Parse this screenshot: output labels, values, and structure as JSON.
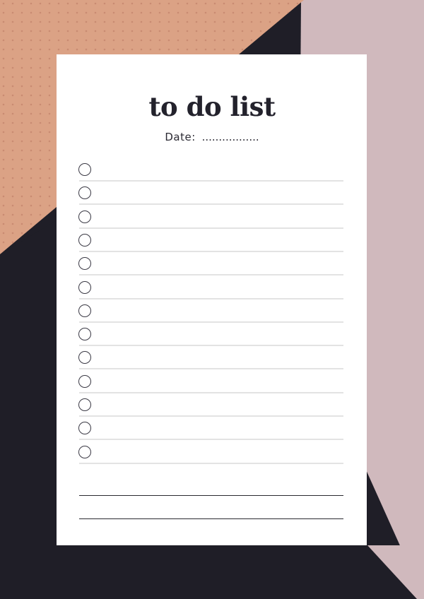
{
  "page": {
    "title": "to do list",
    "date_label": "Date:",
    "date_dots": "................."
  },
  "colors": {
    "background_dark": "#1f1e27",
    "peach": "#dba285",
    "peach_dot": "#c98b72",
    "mauve": "#d0b9bd",
    "card": "#ffffff",
    "text": "#23222c",
    "rule_light": "#e3e3e3",
    "rule_dark": "#2a2a30"
  },
  "tasks": [
    {
      "checked": false
    },
    {
      "checked": false
    },
    {
      "checked": false
    },
    {
      "checked": false
    },
    {
      "checked": false
    },
    {
      "checked": false
    },
    {
      "checked": false
    },
    {
      "checked": false
    },
    {
      "checked": false
    },
    {
      "checked": false
    },
    {
      "checked": false
    },
    {
      "checked": false
    },
    {
      "checked": false
    }
  ],
  "icons": {
    "task_checkbox": "circle-checkbox-icon"
  }
}
